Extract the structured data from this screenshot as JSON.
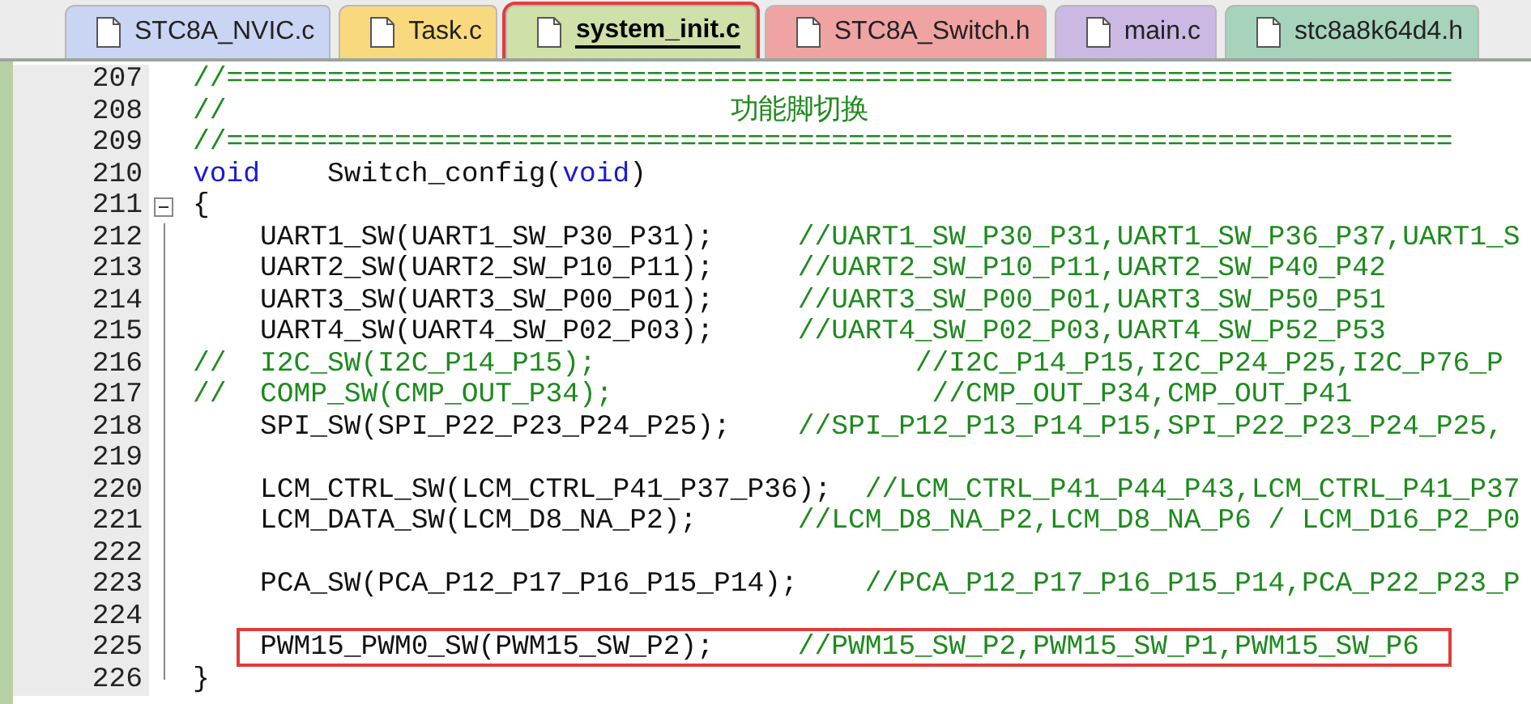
{
  "tabs": [
    {
      "label": "STC8A_NVIC.c",
      "color": "#c9d5f2",
      "selected": false,
      "highlighted": false
    },
    {
      "label": "Task.c",
      "color": "#f9d97e",
      "selected": false,
      "highlighted": false
    },
    {
      "label": "system_init.c",
      "color": "#cfe0a8",
      "selected": true,
      "highlighted": true
    },
    {
      "label": "STC8A_Switch.h",
      "color": "#f0a3a3",
      "selected": false,
      "highlighted": false
    },
    {
      "label": "main.c",
      "color": "#cbb8e3",
      "selected": false,
      "highlighted": false
    },
    {
      "label": "stc8a8k64d4.h",
      "color": "#a7d3bd",
      "selected": false,
      "highlighted": false
    }
  ],
  "editor": {
    "lines": [
      {
        "number": "207",
        "fold": false,
        "highlighted": false,
        "tokens": [
          {
            "kind": "comment",
            "text": "//========================================================================="
          }
        ]
      },
      {
        "number": "208",
        "fold": false,
        "highlighted": false,
        "tokens": [
          {
            "kind": "comment",
            "text": "//                              功能脚切换"
          }
        ]
      },
      {
        "number": "209",
        "fold": false,
        "highlighted": false,
        "tokens": [
          {
            "kind": "comment",
            "text": "//========================================================================="
          }
        ]
      },
      {
        "number": "210",
        "fold": false,
        "highlighted": false,
        "tokens": [
          {
            "kind": "keyword",
            "text": "void"
          },
          {
            "kind": "code",
            "text": "    Switch_config("
          },
          {
            "kind": "keyword",
            "text": "void"
          },
          {
            "kind": "code",
            "text": ")"
          }
        ]
      },
      {
        "number": "211",
        "fold": true,
        "highlighted": false,
        "tokens": [
          {
            "kind": "code",
            "text": "{"
          }
        ]
      },
      {
        "number": "212",
        "fold": false,
        "highlighted": false,
        "tokens": [
          {
            "kind": "code",
            "text": "    UART1_SW(UART1_SW_P30_P31);     "
          },
          {
            "kind": "comment",
            "text": "//UART1_SW_P30_P31,UART1_SW_P36_P37,UART1_S"
          }
        ]
      },
      {
        "number": "213",
        "fold": false,
        "highlighted": false,
        "tokens": [
          {
            "kind": "code",
            "text": "    UART2_SW(UART2_SW_P10_P11);     "
          },
          {
            "kind": "comment",
            "text": "//UART2_SW_P10_P11,UART2_SW_P40_P42"
          }
        ]
      },
      {
        "number": "214",
        "fold": false,
        "highlighted": false,
        "tokens": [
          {
            "kind": "code",
            "text": "    UART3_SW(UART3_SW_P00_P01);     "
          },
          {
            "kind": "comment",
            "text": "//UART3_SW_P00_P01,UART3_SW_P50_P51"
          }
        ]
      },
      {
        "number": "215",
        "fold": false,
        "highlighted": false,
        "tokens": [
          {
            "kind": "code",
            "text": "    UART4_SW(UART4_SW_P02_P03);     "
          },
          {
            "kind": "comment",
            "text": "//UART4_SW_P02_P03,UART4_SW_P52_P53"
          }
        ]
      },
      {
        "number": "216",
        "fold": false,
        "highlighted": false,
        "tokens": [
          {
            "kind": "comment",
            "text": "//  I2C_SW(I2C_P14_P15);                   //I2C_P14_P15,I2C_P24_P25,I2C_P76_P"
          }
        ]
      },
      {
        "number": "217",
        "fold": false,
        "highlighted": false,
        "tokens": [
          {
            "kind": "comment",
            "text": "//  COMP_SW(CMP_OUT_P34);                   //CMP_OUT_P34,CMP_OUT_P41"
          }
        ]
      },
      {
        "number": "218",
        "fold": false,
        "highlighted": false,
        "tokens": [
          {
            "kind": "code",
            "text": "    SPI_SW(SPI_P22_P23_P24_P25);    "
          },
          {
            "kind": "comment",
            "text": "//SPI_P12_P13_P14_P15,SPI_P22_P23_P24_P25,"
          }
        ]
      },
      {
        "number": "219",
        "fold": false,
        "highlighted": false
      },
      {
        "number": "220",
        "fold": false,
        "highlighted": false,
        "tokens": [
          {
            "kind": "code",
            "text": "    LCM_CTRL_SW(LCM_CTRL_P41_P37_P36);  "
          },
          {
            "kind": "comment",
            "text": "//LCM_CTRL_P41_P44_P43,LCM_CTRL_P41_P37"
          }
        ]
      },
      {
        "number": "221",
        "fold": false,
        "highlighted": false,
        "tokens": [
          {
            "kind": "code",
            "text": "    LCM_DATA_SW(LCM_D8_NA_P2);      "
          },
          {
            "kind": "comment",
            "text": "//LCM_D8_NA_P2,LCM_D8_NA_P6 / LCM_D16_P2_P0"
          }
        ]
      },
      {
        "number": "222",
        "fold": false,
        "highlighted": false
      },
      {
        "number": "223",
        "fold": false,
        "highlighted": false,
        "tokens": [
          {
            "kind": "code",
            "text": "    PCA_SW(PCA_P12_P17_P16_P15_P14);    "
          },
          {
            "kind": "comment",
            "text": "//PCA_P12_P17_P16_P15_P14,PCA_P22_P23_P"
          }
        ]
      },
      {
        "number": "224",
        "fold": false,
        "highlighted": false
      },
      {
        "number": "225",
        "fold": false,
        "highlighted": true,
        "tokens": [
          {
            "kind": "code",
            "text": "    PWM15_PWM0_SW(PWM15_SW_P2);     "
          },
          {
            "kind": "comment",
            "text": "//PWM15_SW_P2,PWM15_SW_P1,PWM15_SW_P6"
          }
        ]
      },
      {
        "number": "226",
        "fold": false,
        "highlighted": false,
        "tokens": [
          {
            "kind": "code",
            "text": "}"
          }
        ]
      }
    ]
  }
}
